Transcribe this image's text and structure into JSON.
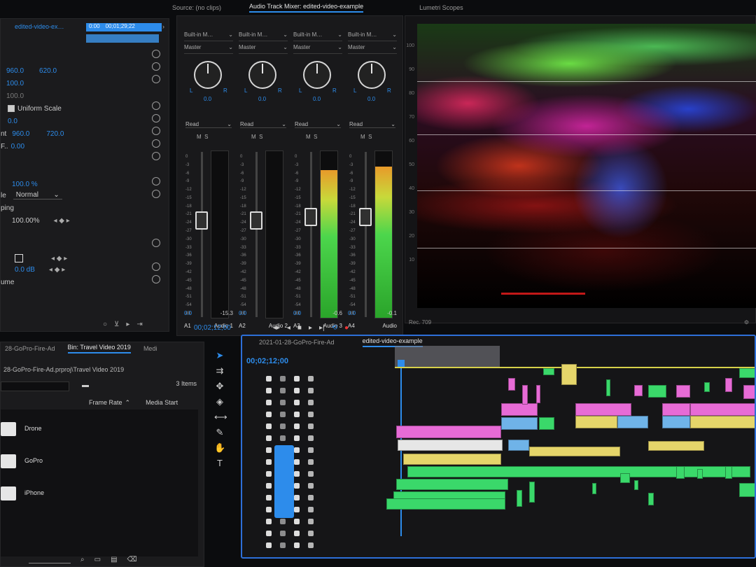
{
  "effect_controls": {
    "clip_tab": "edited-video-ex…",
    "timecode": "0:00",
    "timecode2": "00;01;29;22",
    "position_x": "960.0",
    "position_y": "620.0",
    "scale": "100.0",
    "scale_width": "100.0",
    "uniform_scale_label": "Uniform Scale",
    "rotation": "0.0",
    "anchor_label": "nt",
    "anchor_x": "960.0",
    "anchor_y": "720.0",
    "flicker_label": "F..",
    "flicker_value": "0.00",
    "opacity_value": "100.0 %",
    "blend_label": "le",
    "blend_mode": "Normal",
    "remap_label": "ping",
    "speed_value": "100.00%",
    "volume_value": "0.0 dB",
    "volume_label": "ume"
  },
  "source_tab": "Source: (no clips)",
  "mixer_tab": "Audio Track Mixer: edited-video-example",
  "scope_tab": "Lumetri Scopes",
  "mixer": {
    "channels": [
      {
        "input": "Built-in M…",
        "output": "Master",
        "pan": "0.0",
        "mode": "Read",
        "m": "M",
        "s": "S",
        "fader_level": 0.64,
        "meter_level": 0.0,
        "vol": "0.0",
        "peak": "-15.3",
        "track": "A1",
        "name": "Audio 1"
      },
      {
        "input": "Built-in M…",
        "output": "Master",
        "pan": "0.0",
        "mode": "Read",
        "m": "M",
        "s": "S",
        "fader_level": 0.64,
        "meter_level": 0.0,
        "vol": "0.0",
        "peak": "",
        "track": "A2",
        "name": "Audio 2"
      },
      {
        "input": "Built-in M…",
        "output": "Master",
        "pan": "0.0",
        "mode": "Read",
        "m": "M",
        "s": "S",
        "fader_level": 0.66,
        "meter_level": 0.88,
        "vol": "0.0",
        "peak": "-0.6",
        "track": "A3",
        "name": "Audio 3"
      },
      {
        "input": "Built-in M…",
        "output": "Master",
        "pan": "0.0",
        "mode": "Read",
        "m": "M",
        "s": "S",
        "fader_level": 0.66,
        "meter_level": 0.9,
        "vol": "0.0",
        "peak": "-0.1",
        "track": "A4",
        "name": "Audio"
      }
    ],
    "timecode": "00;02;12;00",
    "scale_ticks": [
      "0",
      "-3",
      "-6",
      "-9",
      "-12",
      "-15",
      "-18",
      "-21",
      "-24",
      "-27",
      "-30",
      "-33",
      "-36",
      "-39",
      "-42",
      "-45",
      "-48",
      "-51",
      "-54",
      "dB"
    ]
  },
  "scope": {
    "ticks": [
      "100",
      "90",
      "80",
      "70",
      "60",
      "50",
      "40",
      "30",
      "20",
      "10"
    ],
    "footer_label": "Rec. 709"
  },
  "project": {
    "tabs": [
      "28-GoPro-Fire-Ad",
      "Bin: Travel Video 2019",
      "Medi"
    ],
    "path": "28-GoPro-Fire-Ad.prproj\\Travel Video 2019",
    "items_count": "3 Items",
    "col_frame_rate": "Frame Rate",
    "col_media_start": "Media Start",
    "items": [
      "Drone",
      "GoPro",
      "iPhone"
    ]
  },
  "timeline": {
    "tabs": [
      "2021-01-28-GoPro-Fire-Ad",
      "edited-video-example"
    ],
    "timecode": "00;02;12;00"
  },
  "colors": {
    "accent": "#2d8ceb",
    "clip_pink": "#e76bd6",
    "clip_green": "#3ad86a",
    "clip_yellow": "#e5d56a",
    "clip_blue": "#6fb3e8"
  }
}
